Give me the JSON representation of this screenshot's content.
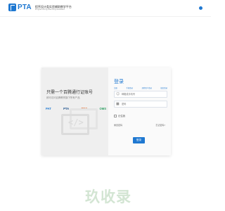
{
  "header": {
    "logo_text": "PTA",
    "subtitle_cn": "程序设计类实验辅助教学平台",
    "subtitle_en": "Programming Teaching Assistant"
  },
  "intro": {
    "title": "只需一个百腾通行证账号",
    "subtitle": "即可访问百腾教育旗下所有产品",
    "brands": [
      "PAT",
      "PTA",
      "PDS",
      "OMS"
    ]
  },
  "login": {
    "title": "登录",
    "tabs": [
      "注册",
      "手机登录",
      "其他用户登录",
      "微信登录"
    ],
    "username_placeholder": "邮箱或手机号",
    "password_placeholder": "密码",
    "remember_label": "记住我",
    "forgot_left": "重置密码",
    "forgot_right": "忘记密码?",
    "submit_label": "登录"
  },
  "watermark": "玖收录",
  "colors": {
    "brand": "#1f78d1",
    "panel_left": "#efefef",
    "panel_right": "#fafafa"
  }
}
